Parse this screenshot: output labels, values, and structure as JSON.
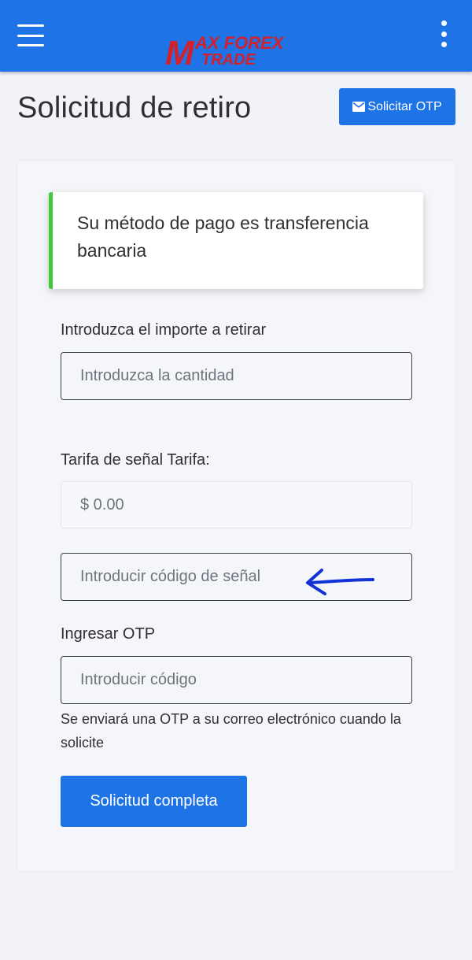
{
  "header": {
    "menu_icon": "hamburger-menu-icon",
    "more_icon": "vertical-dots-icon",
    "logo": {
      "line1": "AX FOREX",
      "line2": "TRADE",
      "monogram": "M"
    }
  },
  "page": {
    "title": "Solicitud de retiro",
    "otp_button_label": "Solicitar OTP",
    "otp_button_icon": "envelope-icon"
  },
  "form": {
    "payment_method_notice": "Su método de pago es transferencia bancaria",
    "amount": {
      "label": "Introduzca el importe a retirar",
      "placeholder": "Introduzca la cantidad",
      "value": ""
    },
    "signal_fee": {
      "label": "Tarifa de señal Tarifa:",
      "value": "$ 0.00"
    },
    "signal_code": {
      "placeholder": "Introducir código de señal",
      "value": ""
    },
    "otp": {
      "label": "Ingresar OTP",
      "placeholder": "Introducir código",
      "value": "",
      "helper": "Se enviará una OTP a su correo electrónico cuando la solicite"
    },
    "submit_label": "Solicitud completa"
  },
  "colors": {
    "primary": "#1e73e6",
    "success_border": "#3ec83a",
    "logo_red": "#d3202a",
    "logo_teal": "#2bb7a3",
    "annotation_blue": "#1232d8"
  }
}
